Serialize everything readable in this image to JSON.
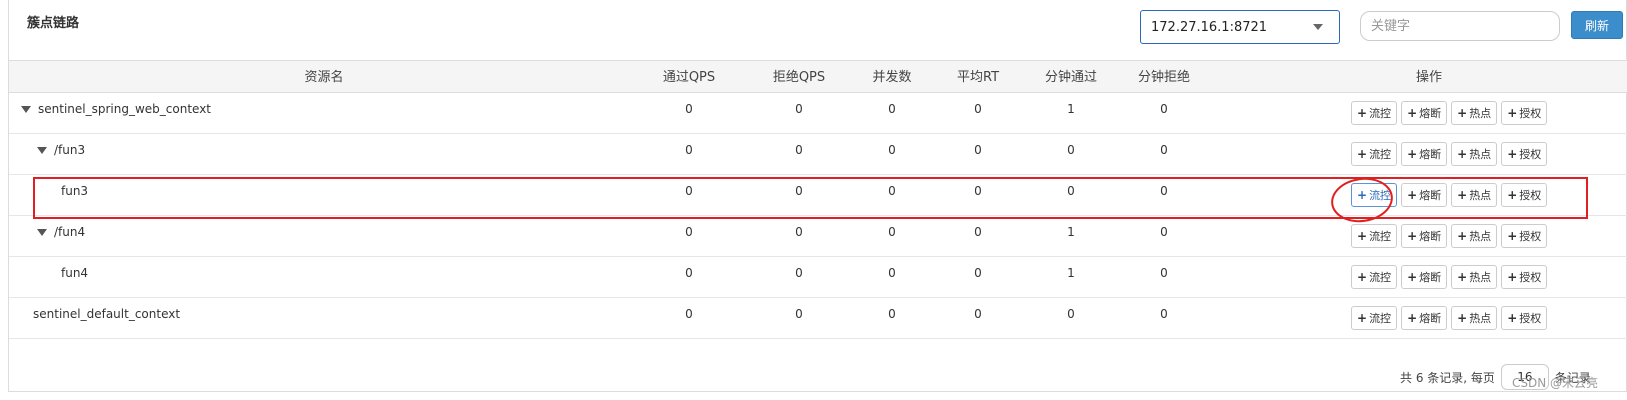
{
  "panel": {
    "title": "簇点链路"
  },
  "toolbar": {
    "machine": "172.27.16.1:8721",
    "search_placeholder": "关键字",
    "refresh_label": "刷新"
  },
  "table": {
    "headers": [
      "资源名",
      "通过QPS",
      "拒绝QPS",
      "并发数",
      "平均RT",
      "分钟通过",
      "分钟拒绝",
      "操作"
    ],
    "op_labels": [
      "流控",
      "熔断",
      "热点",
      "授权"
    ],
    "rows": [
      {
        "name": "sentinel_spring_web_context",
        "pass_qps": "0",
        "block_qps": "0",
        "concurrency": "0",
        "avg_rt": "0",
        "min_pass": "1",
        "min_block": "0"
      },
      {
        "name": "/fun3",
        "pass_qps": "0",
        "block_qps": "0",
        "concurrency": "0",
        "avg_rt": "0",
        "min_pass": "0",
        "min_block": "0"
      },
      {
        "name": "fun3",
        "pass_qps": "0",
        "block_qps": "0",
        "concurrency": "0",
        "avg_rt": "0",
        "min_pass": "0",
        "min_block": "0"
      },
      {
        "name": "/fun4",
        "pass_qps": "0",
        "block_qps": "0",
        "concurrency": "0",
        "avg_rt": "0",
        "min_pass": "1",
        "min_block": "0"
      },
      {
        "name": "fun4",
        "pass_qps": "0",
        "block_qps": "0",
        "concurrency": "0",
        "avg_rt": "0",
        "min_pass": "1",
        "min_block": "0"
      },
      {
        "name": "sentinel_default_context",
        "pass_qps": "0",
        "block_qps": "0",
        "concurrency": "0",
        "avg_rt": "0",
        "min_pass": "0",
        "min_block": "0"
      }
    ]
  },
  "footer": {
    "total_text": "共 6 条记录, 每页",
    "page_size": "16",
    "suffix": "条记录"
  },
  "watermark": "CSDN @宋云亮",
  "colors": {
    "accent": "#3c8dcc",
    "highlight": "#e02020"
  }
}
